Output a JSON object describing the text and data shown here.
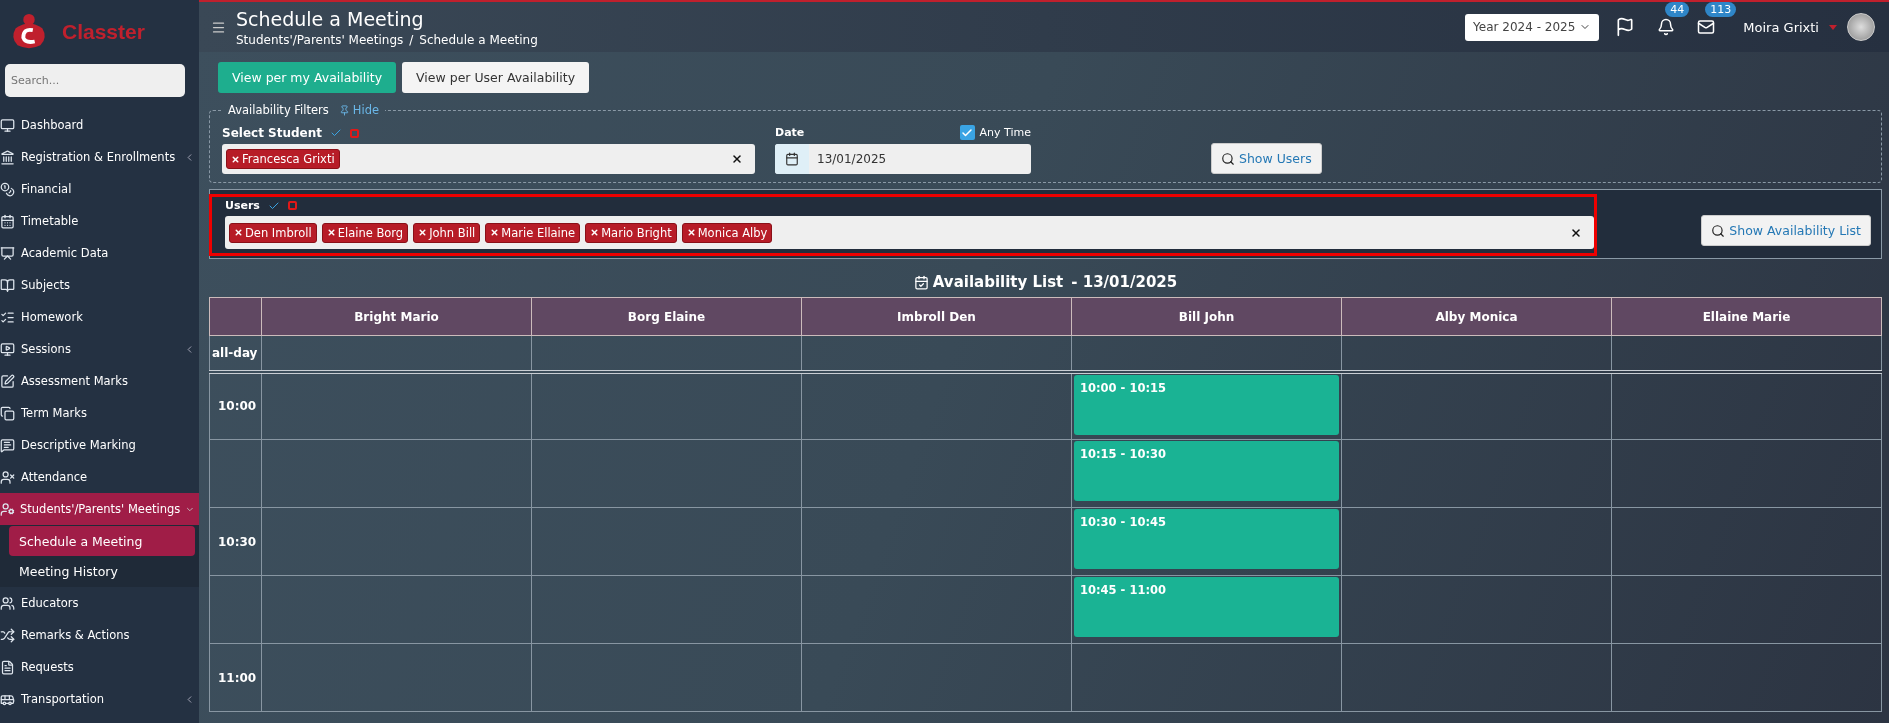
{
  "brand": "Classter",
  "sidebar": {
    "search_placeholder": "Search...",
    "items": [
      {
        "label": "Dashboard",
        "expandable": false,
        "selected": false
      },
      {
        "label": "Registration & Enrollments",
        "expandable": true,
        "selected": false
      },
      {
        "label": "Financial",
        "expandable": false,
        "selected": false
      },
      {
        "label": "Timetable",
        "expandable": false,
        "selected": false
      },
      {
        "label": "Academic Data",
        "expandable": false,
        "selected": false
      },
      {
        "label": "Subjects",
        "expandable": false,
        "selected": false
      },
      {
        "label": "Homework",
        "expandable": false,
        "selected": false
      },
      {
        "label": "Sessions",
        "expandable": true,
        "selected": false
      },
      {
        "label": "Assessment Marks",
        "expandable": false,
        "selected": false
      },
      {
        "label": "Term Marks",
        "expandable": false,
        "selected": false
      },
      {
        "label": "Descriptive Marking",
        "expandable": false,
        "selected": false
      },
      {
        "label": "Attendance",
        "expandable": false,
        "selected": false
      },
      {
        "label": "Students'/Parents' Meetings",
        "expandable": true,
        "selected": true,
        "expanded": true,
        "children": [
          {
            "label": "Schedule a Meeting",
            "selected": true
          },
          {
            "label": "Meeting History",
            "selected": false
          }
        ]
      },
      {
        "label": "Educators",
        "expandable": false,
        "selected": false
      },
      {
        "label": "Remarks & Actions",
        "expandable": false,
        "selected": false
      },
      {
        "label": "Requests",
        "expandable": false,
        "selected": false
      },
      {
        "label": "Transportation",
        "expandable": true,
        "selected": false
      }
    ]
  },
  "header": {
    "title": "Schedule a Meeting",
    "breadcrumb": [
      "Students'/Parents' Meetings",
      "Schedule a Meeting"
    ],
    "breadcrumb_separator": "/",
    "year": "Year 2024 - 2025",
    "notifications": "44",
    "messages": "113",
    "user": "Moira Grixti"
  },
  "view_buttons": [
    {
      "label": "View per my Availability",
      "selected": true
    },
    {
      "label": "View per User Availability",
      "selected": false
    }
  ],
  "filters": {
    "legend": "Availability Filters",
    "hide": "Hide",
    "student_label": "Select Student",
    "students": [
      "Francesca Grixti"
    ],
    "date_label": "Date",
    "date": "13/01/2025",
    "any_time": {
      "label": "Any Time",
      "checked": true
    },
    "button": "Show Users"
  },
  "users": {
    "label": "Users",
    "highlighted": true,
    "tags": [
      "Den Imbroll",
      "Elaine Borg",
      "John Bill",
      "Marie Ellaine",
      "Mario Bright",
      "Monica Alby"
    ],
    "button": "Show Availability List"
  },
  "availability": {
    "title": "Availability List",
    "date": "- 13/01/2025",
    "columns": [
      "Bright Mario",
      "Borg Elaine",
      "Imbroll Den",
      "Bill John",
      "Alby Monica",
      "Ellaine Marie"
    ],
    "all_day": "all-day",
    "rows": [
      {
        "time": "10:00",
        "cells": [
          {},
          {},
          {},
          {
            "event": "10:00 - 10:15"
          },
          {},
          {}
        ]
      },
      {
        "cells": [
          {},
          {},
          {},
          {
            "event": "10:15 - 10:30"
          },
          {},
          {}
        ]
      },
      {
        "time": "10:30",
        "cells": [
          {},
          {},
          {},
          {
            "event": "10:30 - 10:45"
          },
          {},
          {}
        ]
      },
      {
        "cells": [
          {},
          {},
          {},
          {
            "event": "10:45 - 11:00"
          },
          {},
          {}
        ]
      },
      {
        "time": "11:00",
        "cells": [
          {},
          {},
          {},
          {},
          {},
          {}
        ]
      }
    ]
  }
}
